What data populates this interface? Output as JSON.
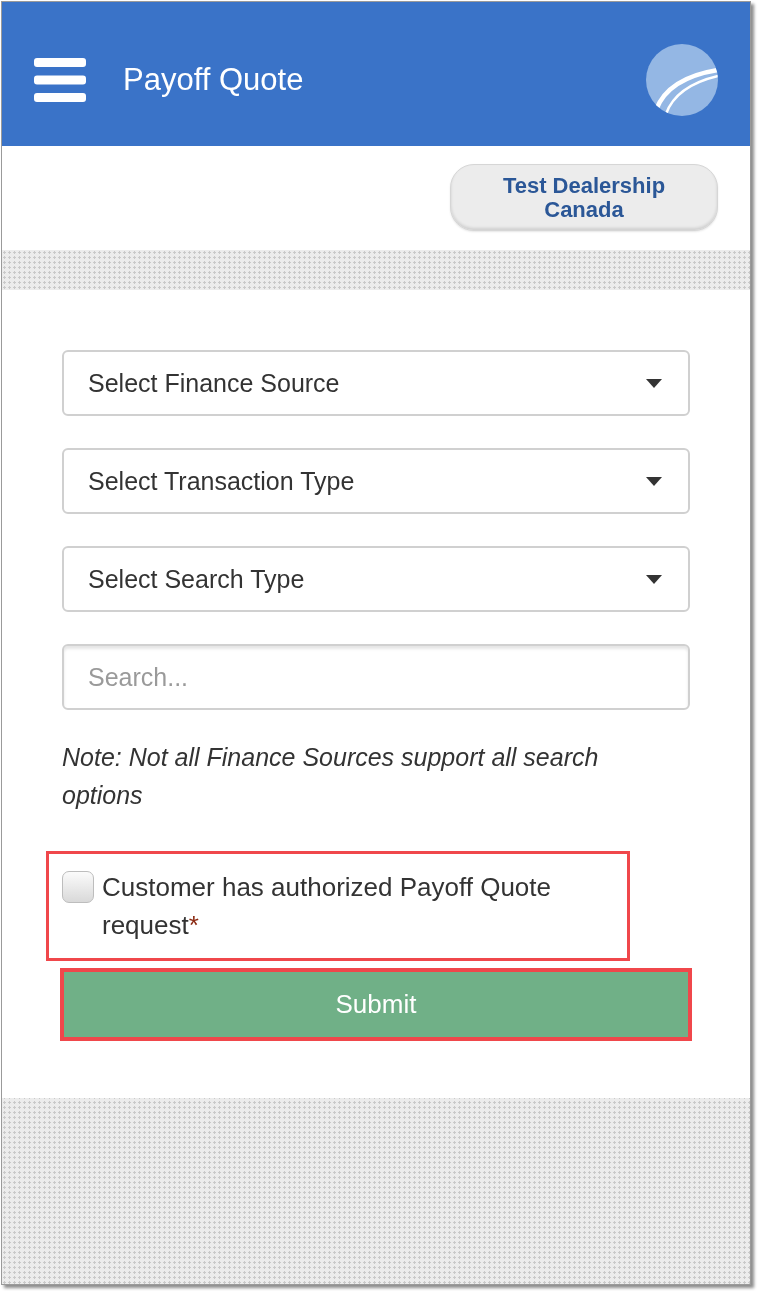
{
  "header": {
    "title": "Payoff Quote"
  },
  "dealer_button": {
    "label": "Test Dealership Canada"
  },
  "form": {
    "fields": [
      {
        "kind": "select",
        "placeholder": "Select Finance Source"
      },
      {
        "kind": "select",
        "placeholder": "Select Transaction Type"
      },
      {
        "kind": "select",
        "placeholder": "Select Search Type"
      },
      {
        "kind": "search",
        "placeholder": "Search..."
      }
    ],
    "note": "Note: Not all Finance Sources support all search options",
    "authorization": {
      "label": "Customer has authorized Payoff Quote request",
      "required_mark": "*",
      "checked": false,
      "highlighted": true
    },
    "submit": {
      "label": "Submit",
      "highlighted": true
    }
  }
}
